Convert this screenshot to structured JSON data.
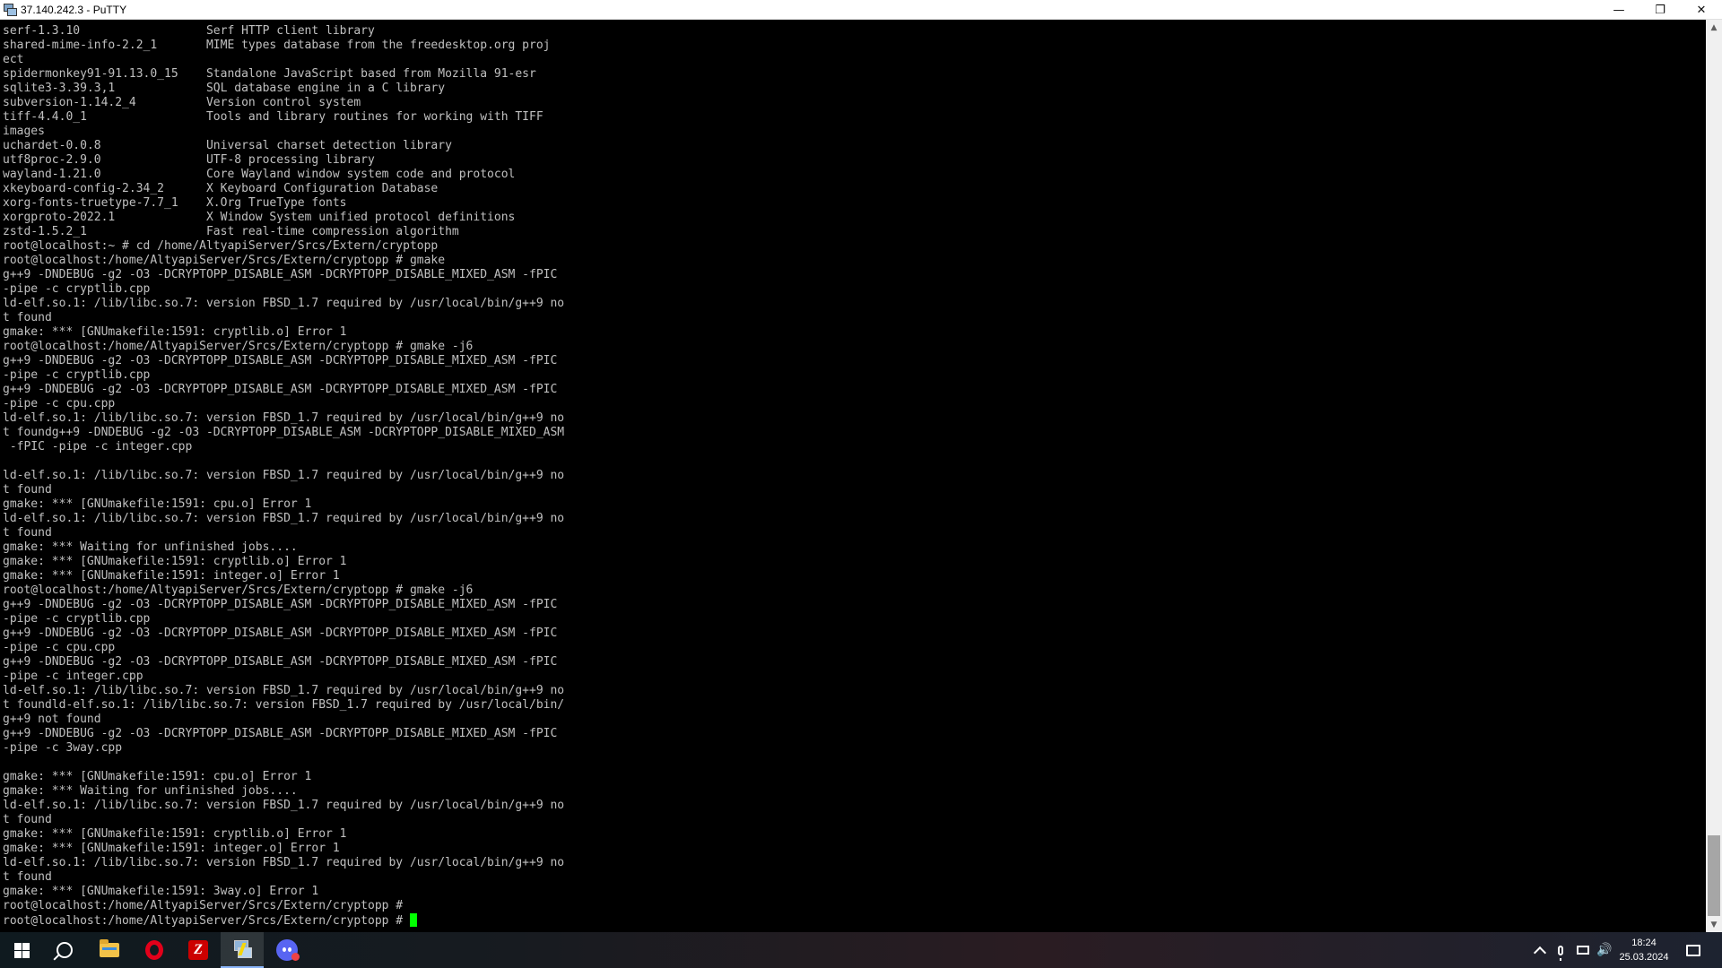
{
  "window": {
    "title": "37.140.242.3 - PuTTY",
    "controls": {
      "minimize": "—",
      "restore": "❐",
      "close": "✕"
    }
  },
  "terminal": {
    "lines": [
      "serf-1.3.10                  Serf HTTP client library",
      "shared-mime-info-2.2_1       MIME types database from the freedesktop.org proj",
      "ect",
      "spidermonkey91-91.13.0_15    Standalone JavaScript based from Mozilla 91-esr",
      "sqlite3-3.39.3,1             SQL database engine in a C library",
      "subversion-1.14.2_4          Version control system",
      "tiff-4.4.0_1                 Tools and library routines for working with TIFF",
      "images",
      "uchardet-0.0.8               Universal charset detection library",
      "utf8proc-2.9.0               UTF-8 processing library",
      "wayland-1.21.0               Core Wayland window system code and protocol",
      "xkeyboard-config-2.34_2      X Keyboard Configuration Database",
      "xorg-fonts-truetype-7.7_1    X.Org TrueType fonts",
      "xorgproto-2022.1             X Window System unified protocol definitions",
      "zstd-1.5.2_1                 Fast real-time compression algorithm",
      "root@localhost:~ # cd /home/AltyapiServer/Srcs/Extern/cryptopp",
      "root@localhost:/home/AltyapiServer/Srcs/Extern/cryptopp # gmake",
      "g++9 -DNDEBUG -g2 -O3 -DCRYPTOPP_DISABLE_ASM -DCRYPTOPP_DISABLE_MIXED_ASM -fPIC",
      "-pipe -c cryptlib.cpp",
      "ld-elf.so.1: /lib/libc.so.7: version FBSD_1.7 required by /usr/local/bin/g++9 no",
      "t found",
      "gmake: *** [GNUmakefile:1591: cryptlib.o] Error 1",
      "root@localhost:/home/AltyapiServer/Srcs/Extern/cryptopp # gmake -j6",
      "g++9 -DNDEBUG -g2 -O3 -DCRYPTOPP_DISABLE_ASM -DCRYPTOPP_DISABLE_MIXED_ASM -fPIC",
      "-pipe -c cryptlib.cpp",
      "g++9 -DNDEBUG -g2 -O3 -DCRYPTOPP_DISABLE_ASM -DCRYPTOPP_DISABLE_MIXED_ASM -fPIC",
      "-pipe -c cpu.cpp",
      "ld-elf.so.1: /lib/libc.so.7: version FBSD_1.7 required by /usr/local/bin/g++9 no",
      "t foundg++9 -DNDEBUG -g2 -O3 -DCRYPTOPP_DISABLE_ASM -DCRYPTOPP_DISABLE_MIXED_ASM",
      " -fPIC -pipe -c integer.cpp",
      "",
      "ld-elf.so.1: /lib/libc.so.7: version FBSD_1.7 required by /usr/local/bin/g++9 no",
      "t found",
      "gmake: *** [GNUmakefile:1591: cpu.o] Error 1",
      "ld-elf.so.1: /lib/libc.so.7: version FBSD_1.7 required by /usr/local/bin/g++9 no",
      "t found",
      "gmake: *** Waiting for unfinished jobs....",
      "gmake: *** [GNUmakefile:1591: cryptlib.o] Error 1",
      "gmake: *** [GNUmakefile:1591: integer.o] Error 1",
      "root@localhost:/home/AltyapiServer/Srcs/Extern/cryptopp # gmake -j6",
      "g++9 -DNDEBUG -g2 -O3 -DCRYPTOPP_DISABLE_ASM -DCRYPTOPP_DISABLE_MIXED_ASM -fPIC",
      "-pipe -c cryptlib.cpp",
      "g++9 -DNDEBUG -g2 -O3 -DCRYPTOPP_DISABLE_ASM -DCRYPTOPP_DISABLE_MIXED_ASM -fPIC",
      "-pipe -c cpu.cpp",
      "g++9 -DNDEBUG -g2 -O3 -DCRYPTOPP_DISABLE_ASM -DCRYPTOPP_DISABLE_MIXED_ASM -fPIC",
      "-pipe -c integer.cpp",
      "ld-elf.so.1: /lib/libc.so.7: version FBSD_1.7 required by /usr/local/bin/g++9 no",
      "t foundld-elf.so.1: /lib/libc.so.7: version FBSD_1.7 required by /usr/local/bin/",
      "g++9 not found",
      "g++9 -DNDEBUG -g2 -O3 -DCRYPTOPP_DISABLE_ASM -DCRYPTOPP_DISABLE_MIXED_ASM -fPIC",
      "-pipe -c 3way.cpp",
      "",
      "gmake: *** [GNUmakefile:1591: cpu.o] Error 1",
      "gmake: *** Waiting for unfinished jobs....",
      "ld-elf.so.1: /lib/libc.so.7: version FBSD_1.7 required by /usr/local/bin/g++9 no",
      "t found",
      "gmake: *** [GNUmakefile:1591: cryptlib.o] Error 1",
      "gmake: *** [GNUmakefile:1591: integer.o] Error 1",
      "ld-elf.so.1: /lib/libc.so.7: version FBSD_1.7 required by /usr/local/bin/g++9 no",
      "t found",
      "gmake: *** [GNUmakefile:1591: 3way.o] Error 1",
      "root@localhost:/home/AltyapiServer/Srcs/Extern/cryptopp #",
      "root@localhost:/home/AltyapiServer/Srcs/Extern/cryptopp # "
    ],
    "text_color": "#c0c0c0",
    "cursor_color": "#00ff00"
  },
  "taskbar": {
    "items": [
      {
        "name": "start-button",
        "icon": "windows-logo-icon"
      },
      {
        "name": "search-button",
        "icon": "search-icon"
      },
      {
        "name": "file-explorer",
        "icon": "folder-icon"
      },
      {
        "name": "opera-browser",
        "icon": "opera-icon"
      },
      {
        "name": "filezilla",
        "icon": "filezilla-icon"
      },
      {
        "name": "putty",
        "icon": "putty-icon",
        "active": true
      },
      {
        "name": "discord",
        "icon": "discord-icon"
      }
    ],
    "clock": {
      "time": "18:24",
      "date": "25.03.2024"
    },
    "tray_icons": [
      "chevron-up-icon",
      "microphone-icon",
      "network-icon",
      "volume-icon",
      "notification-icon"
    ]
  }
}
